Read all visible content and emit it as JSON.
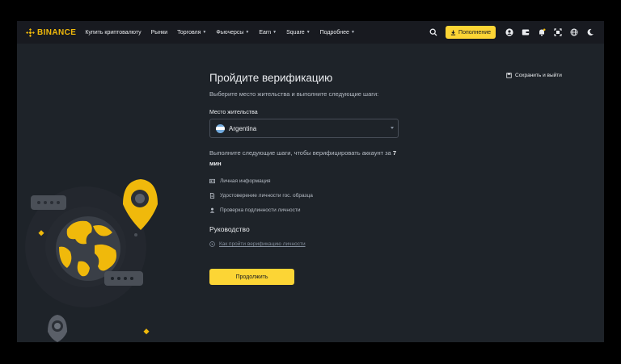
{
  "brand": {
    "name": "BINANCE",
    "accent": "#f0b90b",
    "button_color": "#fcd535"
  },
  "nav": {
    "items": [
      {
        "label": "Купить криптовалюту",
        "dropdown": false
      },
      {
        "label": "Рынки",
        "dropdown": false
      },
      {
        "label": "Торговля",
        "dropdown": true
      },
      {
        "label": "Фьючерсы",
        "dropdown": true
      },
      {
        "label": "Earn",
        "dropdown": true
      },
      {
        "label": "Square",
        "dropdown": true
      },
      {
        "label": "Подробнее",
        "dropdown": true
      }
    ],
    "deposit_label": "Пополнение",
    "icons": [
      "search-icon",
      "download-icon",
      "profile-icon",
      "wallet-icon",
      "bell-icon",
      "qr-scan-icon",
      "globe-icon",
      "moon-icon"
    ]
  },
  "page": {
    "title": "Пройдите верификацию",
    "subtitle": "Выберите место жительства и выполните следующие шаги:",
    "residence_label": "Место жительства",
    "residence_value": "Argentina",
    "steps_intro": "Выполните следующие шаги, чтобы верифицировать аккаунт за",
    "steps_time": "7 мин",
    "steps": [
      {
        "label": "Личная информация",
        "icon": "id-card-icon"
      },
      {
        "label": "Удостоверение личности гос. образца",
        "icon": "document-icon"
      },
      {
        "label": "Проверка подлинности личности",
        "icon": "person-icon"
      }
    ],
    "guide_title": "Руководство",
    "guide_link": "Как пройти верификацию личности",
    "continue_label": "Продолжить",
    "save_exit_label": "Сохранить и выйти"
  }
}
